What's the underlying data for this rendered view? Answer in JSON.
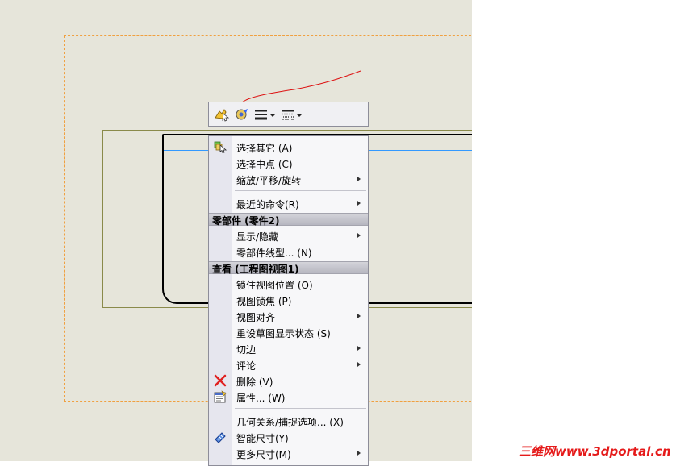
{
  "toolbar": {
    "buttons": [
      {
        "icon": "select-tool-icon"
      },
      {
        "icon": "display-style-icon"
      },
      {
        "icon": "line-thickness-icon"
      },
      {
        "icon": "line-style-icon"
      }
    ]
  },
  "menu": {
    "items_top": [
      {
        "label": "选择其它 (A)",
        "icon": "select-other-icon",
        "submenu": false
      },
      {
        "label": "选择中点 (C)",
        "icon": "",
        "submenu": false
      },
      {
        "label": "缩放/平移/旋转",
        "icon": "",
        "submenu": true
      }
    ],
    "recent": {
      "label": "最近的命令(R)",
      "submenu": true
    },
    "component_header": "零部件 (零件2)",
    "component_items": [
      {
        "label": "显示/隐藏",
        "submenu": true
      },
      {
        "label": "零部件线型... (N)",
        "submenu": false
      }
    ],
    "view_header": "查看 (工程图视图1)",
    "view_items": [
      {
        "label": "锁住视图位置 (O)",
        "submenu": false
      },
      {
        "label": "视图锁焦 (P)",
        "submenu": false
      },
      {
        "label": "视图对齐",
        "submenu": true
      },
      {
        "label": "重设草图显示状态 (S)",
        "submenu": false
      },
      {
        "label": "切边",
        "submenu": true
      },
      {
        "label": "评论",
        "submenu": true
      },
      {
        "label": "删除 (V)",
        "icon": "delete-icon",
        "submenu": false
      },
      {
        "label": "属性... (W)",
        "icon": "properties-icon",
        "submenu": false
      }
    ],
    "bottom_items": [
      {
        "label": "几何关系/捕捉选项... (X)",
        "submenu": false
      },
      {
        "label": "智能尺寸(Y)",
        "icon": "smart-dimension-icon",
        "submenu": false
      },
      {
        "label": "更多尺寸(M)",
        "submenu": true
      }
    ]
  },
  "watermark": "三维网www.3dportal.cn",
  "colors": {
    "canvas": "#e6e5da",
    "sheet_border": "#f0a040",
    "center_line": "#3399ff",
    "annotation": "#dd1111",
    "watermark": "#e51a1a"
  }
}
